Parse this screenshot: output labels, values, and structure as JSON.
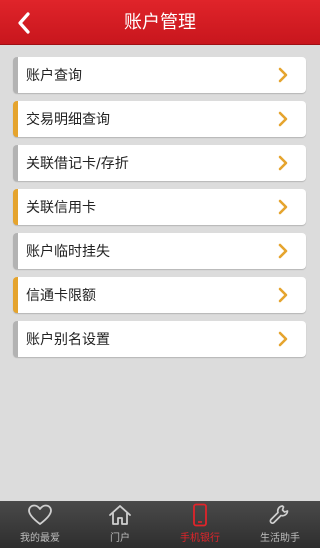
{
  "header": {
    "title": "账户管理"
  },
  "menu": [
    {
      "label": "账户查询",
      "accent": false
    },
    {
      "label": "交易明细查询",
      "accent": true
    },
    {
      "label": "关联借记卡/存折",
      "accent": false
    },
    {
      "label": "关联信用卡",
      "accent": true
    },
    {
      "label": "账户临时挂失",
      "accent": false
    },
    {
      "label": "信通卡限额",
      "accent": true
    },
    {
      "label": "账户别名设置",
      "accent": false
    }
  ],
  "tabbar": {
    "items": [
      {
        "label": "我的最爱",
        "icon": "heart-icon",
        "active": false
      },
      {
        "label": "门户",
        "icon": "home-icon",
        "active": false
      },
      {
        "label": "手机银行",
        "icon": "mobile-phone-icon",
        "active": true
      },
      {
        "label": "生活助手",
        "icon": "wrench-icon",
        "active": false
      }
    ]
  },
  "colors": {
    "header": "#d21c22",
    "accent_bar": "#e5a42e",
    "default_bar": "#b3b3b3",
    "chevron": "#e5a42e",
    "active_tab": "#e0242a"
  }
}
